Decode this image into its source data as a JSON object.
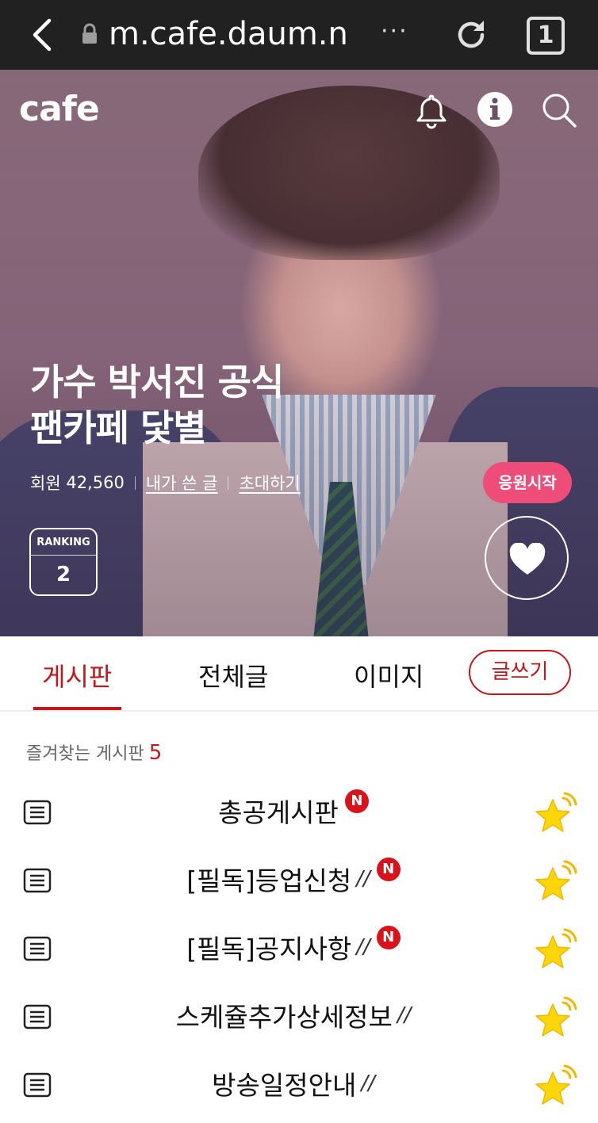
{
  "browser": {
    "url": "m.cafe.daum.n",
    "more": "···",
    "tab_count": "1"
  },
  "header": {
    "logo": "cafe"
  },
  "cafe": {
    "title_line1": "가수 박서진 공식",
    "title_line2": "팬카페 닻별",
    "members_label": "회원",
    "members_count": "42,560",
    "my_posts": "내가 쓴 글",
    "invite": "초대하기",
    "cheer_button": "응원시작",
    "ranking_label": "RANKING",
    "ranking_value": "2"
  },
  "tabs": {
    "board": "게시판",
    "all_posts": "전체글",
    "images": "이미지",
    "write": "글쓰기"
  },
  "favorites": {
    "label": "즐겨찾는 게시판",
    "count": "5",
    "items": [
      {
        "name": "총공게시판",
        "slashes": "",
        "new": "N"
      },
      {
        "name": "[필독]등업신청",
        "slashes": "//",
        "new": "N"
      },
      {
        "name": "[필독]공지사항",
        "slashes": "//",
        "new": "N"
      },
      {
        "name": "스케쥴추가상세정보",
        "slashes": "//",
        "new": ""
      },
      {
        "name": "방송일정안내",
        "slashes": "//",
        "new": ""
      }
    ]
  },
  "colors": {
    "accent_red": "#c4161c",
    "cheer_pink": "#ee4d7a",
    "star_yellow": "#ffd60a"
  }
}
